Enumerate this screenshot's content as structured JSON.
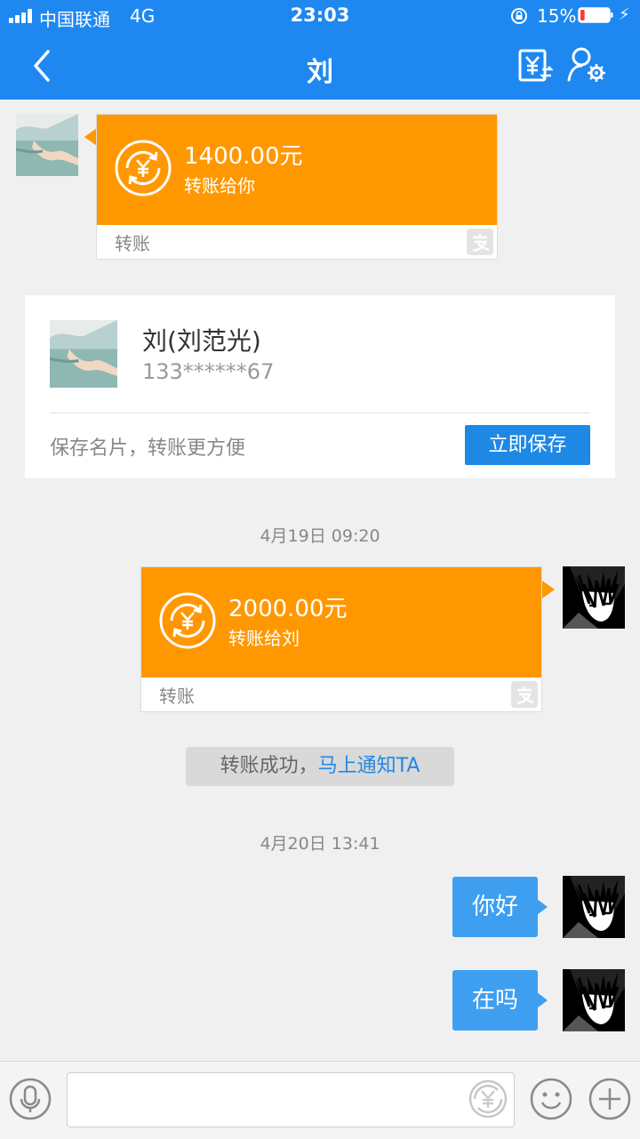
{
  "status_bar": {
    "carrier": "中国联通",
    "network": "4G",
    "time": "23:03",
    "battery_percent": "15%",
    "battery_level": 0.15,
    "battery_color": "#ff3b30"
  },
  "nav": {
    "back_icon": "chevron-left-icon",
    "title": "刘",
    "transfer_icon": "yen-transfer-icon",
    "settings_icon": "user-settings-icon"
  },
  "messages": {
    "transfer_in": {
      "amount": "1400.00元",
      "subtitle": "转账给你",
      "label": "转账"
    },
    "contact_card": {
      "name": "刘(刘范光)",
      "phone": "133******67",
      "prompt": "保存名片，转账更方便",
      "save_button": "立即保存"
    },
    "timestamp_1": "4月19日 09:20",
    "transfer_out": {
      "amount": "2000.00元",
      "subtitle": "转账给刘",
      "label": "转账"
    },
    "notice": {
      "text": "转账成功，",
      "link": "马上通知TA"
    },
    "timestamp_2": "4月20日 13:41",
    "bubble_1": "你好",
    "bubble_2": "在吗"
  },
  "input_bar": {
    "voice_icon": "microphone-icon",
    "transfer_icon": "yen-coin-icon",
    "emoji_icon": "smiley-icon",
    "more_icon": "plus-icon"
  },
  "colors": {
    "nav_bg": "#1e88f0",
    "transfer_orange": "#ff9800",
    "bubble_blue": "#3e9ff0",
    "link_blue": "#1e88e5"
  }
}
